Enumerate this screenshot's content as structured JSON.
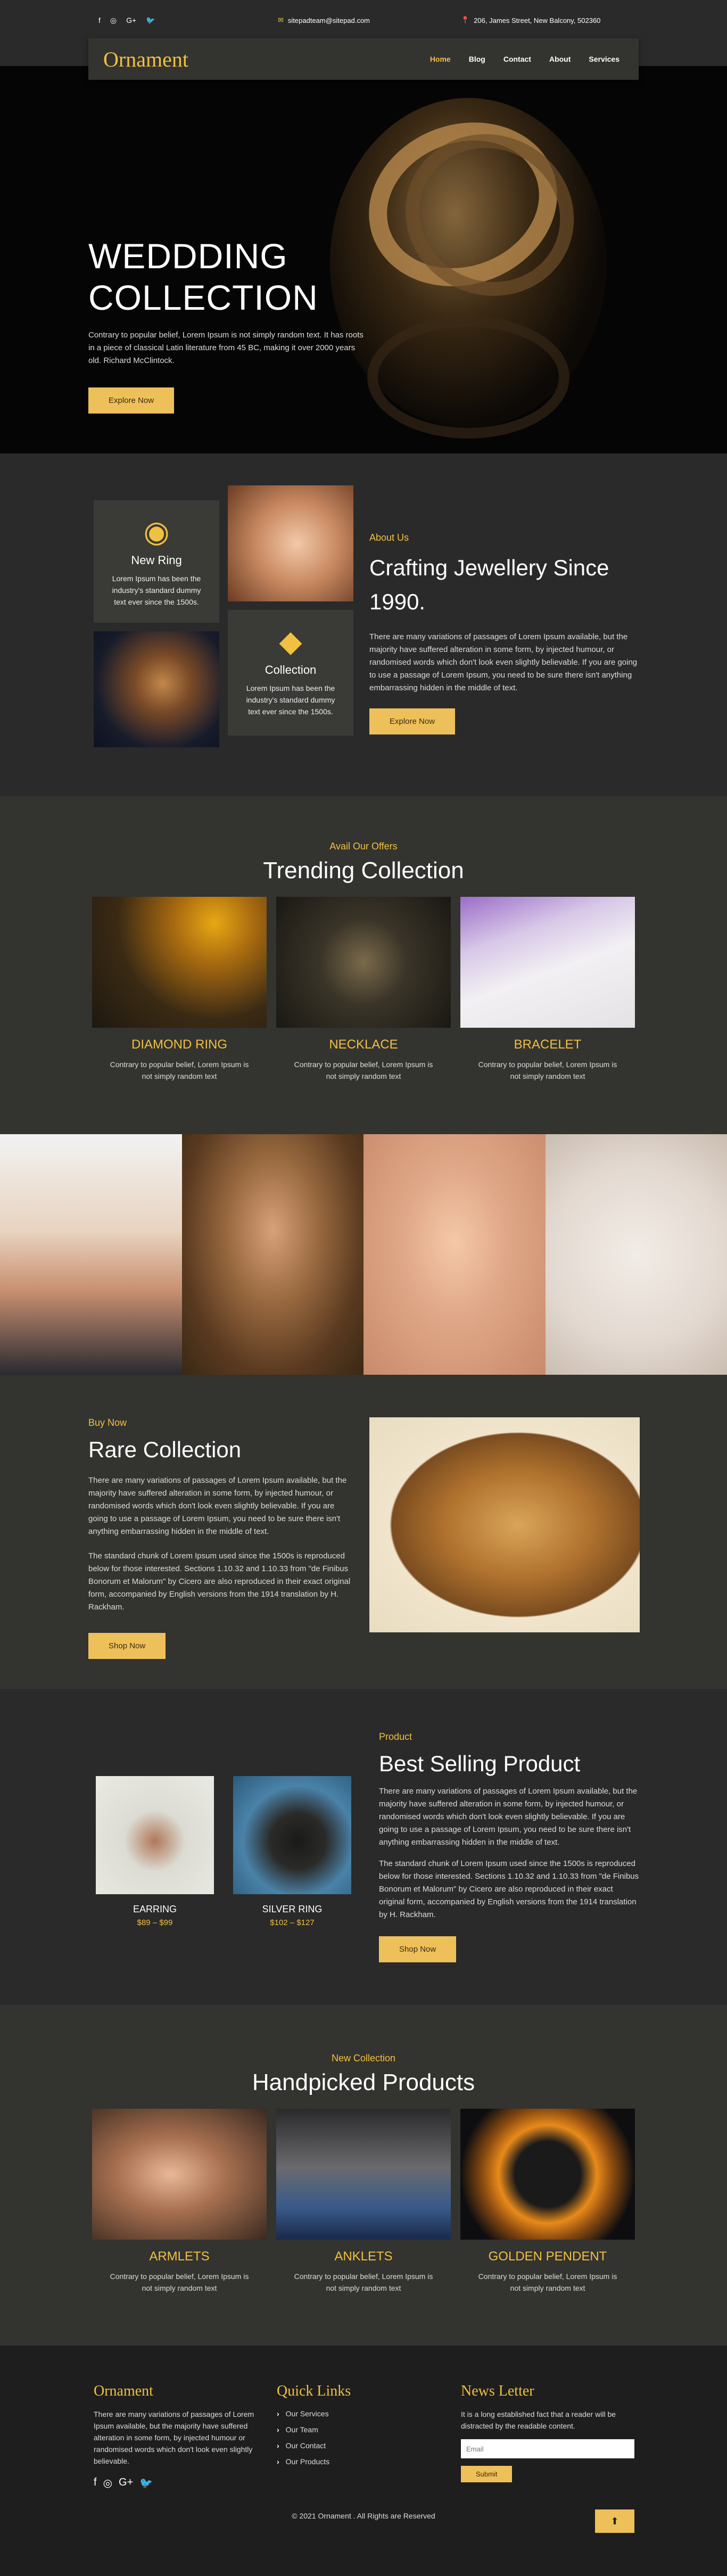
{
  "topbar": {
    "socials": [
      "f",
      "◎",
      "G+",
      "🐦"
    ],
    "email": "sitepadteam@sitepad.com",
    "address": "206, James Street, New Balcony, 502360"
  },
  "nav": {
    "logo": "Ornament",
    "items": [
      "Home",
      "Blog",
      "Contact",
      "About",
      "Services"
    ]
  },
  "hero": {
    "title_line1": "WEDDDING",
    "title_line2": "COLLECTION",
    "text": "Contrary to popular belief, Lorem Ipsum is not simply random text. It has roots in a piece of classical Latin literature from 45 BC, making it over 2000 years old. Richard McClintock.",
    "button": "Explore Now"
  },
  "about": {
    "card1_title": "New Ring",
    "card1_text": "Lorem Ipsum has been the industry's standard dummy text ever since the 1500s.",
    "card2_title": "Collection",
    "card2_text": "Lorem Ipsum has been the industry's standard dummy text ever since the 1500s.",
    "small": "About Us",
    "title": "Crafting Jewellery Since 1990.",
    "text": "There are many variations of passages of Lorem Ipsum available, but the majority have suffered alteration in some form, by injected humour, or randomised words which don't look even slightly believable. If you are going to use a passage of Lorem Ipsum, you need to be sure there isn't anything embarrassing hidden in the middle of text.",
    "button": "Explore Now"
  },
  "trending": {
    "small": "Avail Our Offers",
    "title": "Trending Collection",
    "items": [
      {
        "name": "DIAMOND RING",
        "text": "Contrary to popular belief, Lorem Ipsum is not simply random text"
      },
      {
        "name": "NECKLACE",
        "text": "Contrary to popular belief, Lorem Ipsum is not simply random text"
      },
      {
        "name": "BRACELET",
        "text": "Contrary to popular belief, Lorem Ipsum is not simply random text"
      }
    ]
  },
  "rare": {
    "small": "Buy Now",
    "title": "Rare Collection",
    "p1": "There are many variations of passages of Lorem Ipsum available, but the majority have suffered alteration in some form, by injected humour, or randomised words which don't look even slightly believable. If you are going to use a passage of Lorem Ipsum, you need to be sure there isn't anything embarrassing hidden in the middle of text.",
    "p2": "The standard chunk of Lorem Ipsum used since the 1500s is reproduced below for those interested. Sections 1.10.32 and 1.10.33 from \"de Finibus Bonorum et Malorum\" by Cicero are also reproduced in their exact original form, accompanied by English versions from the 1914 translation by H. Rackham.",
    "button": "Shop Now"
  },
  "best": {
    "products": [
      {
        "name": "EARRING",
        "price": "$89 – $99"
      },
      {
        "name": "SILVER RING",
        "price": "$102 – $127"
      }
    ],
    "small": "Product",
    "title": "Best Selling Product",
    "p1": "There are many variations of passages of Lorem Ipsum available, but the majority have suffered alteration in some form, by injected humour, or randomised words which don't look even slightly believable. If you are going to use a passage of Lorem Ipsum, you need to be sure there isn't anything embarrassing hidden in the middle of text.",
    "p2": "The standard chunk of Lorem Ipsum used since the 1500s is reproduced below for those interested. Sections 1.10.32 and 1.10.33 from \"de Finibus Bonorum et Malorum\" by Cicero are also reproduced in their exact original form, accompanied by English versions from the 1914 translation by H. Rackham.",
    "button": "Shop Now"
  },
  "handpicked": {
    "small": "New Collection",
    "title": "Handpicked Products",
    "items": [
      {
        "name": "ARMLETS",
        "text": "Contrary to popular belief, Lorem Ipsum is not simply random text"
      },
      {
        "name": "ANKLETS",
        "text": "Contrary to popular belief, Lorem Ipsum is not simply random text"
      },
      {
        "name": "GOLDEN PENDENT",
        "text": "Contrary to popular belief, Lorem Ipsum is not simply random text"
      }
    ]
  },
  "footer": {
    "brand": "Ornament",
    "brand_text": "There are many variations of passages of Lorem Ipsum available, but the majority have suffered alteration in some form, by injected humour or randomised words which don't look even slightly believable.",
    "links_title": "Quick Links",
    "links": [
      "Our Services",
      "Our Team",
      "Our Contact",
      "Our Products"
    ],
    "news_title": "News Letter",
    "news_text": "It is a long established fact that a reader will be distracted by the readable content.",
    "email_placeholder": "Email",
    "submit": "Submit",
    "copyright": "© 2021 Ornament . All Rights are Reserved"
  }
}
